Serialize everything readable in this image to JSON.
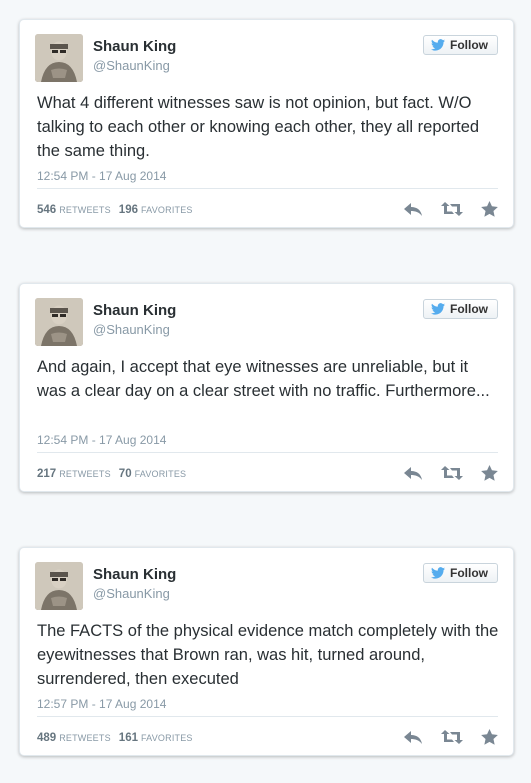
{
  "colors": {
    "page_background": "#f5f8fa",
    "card_border": "#e1e8ed",
    "text": "#292f33",
    "muted": "#8899a6",
    "twitter_blue": "#55acee",
    "action_icon": "#7a8793"
  },
  "tweets": [
    {
      "name": "Shaun King",
      "handle": "@ShaunKing",
      "follow_label": "Follow",
      "text": "What 4 different witnesses saw is not opinion, but fact. W/O talking to each other or knowing each other, they all reported the same thing.",
      "timestamp": "12:54 PM - 17 Aug 2014",
      "retweets": "546",
      "retweets_label": "RETWEETS",
      "favorites": "196",
      "favorites_label": "FAVORITES",
      "icons": [
        "reply-icon",
        "retweet-icon",
        "favorite-star-icon"
      ]
    },
    {
      "name": "Shaun King",
      "handle": "@ShaunKing",
      "follow_label": "Follow",
      "text": "And again, I accept that eye witnesses are unreliable, but it was a clear day on a clear street with no traffic. Furthermore...",
      "timestamp": "12:54 PM - 17 Aug 2014",
      "retweets": "217",
      "retweets_label": "RETWEETS",
      "favorites": "70",
      "favorites_label": "FAVORITES",
      "icons": [
        "reply-icon",
        "retweet-icon",
        "favorite-star-icon"
      ]
    },
    {
      "name": "Shaun King",
      "handle": "@ShaunKing",
      "follow_label": "Follow",
      "text": "The FACTS of the physical evidence match completely with the eyewitnesses that Brown ran, was hit, turned around, surrendered, then executed",
      "timestamp": "12:57 PM - 17 Aug 2014",
      "retweets": "489",
      "retweets_label": "RETWEETS",
      "favorites": "161",
      "favorites_label": "FAVORITES",
      "icons": [
        "reply-icon",
        "retweet-icon",
        "favorite-star-icon"
      ]
    }
  ]
}
